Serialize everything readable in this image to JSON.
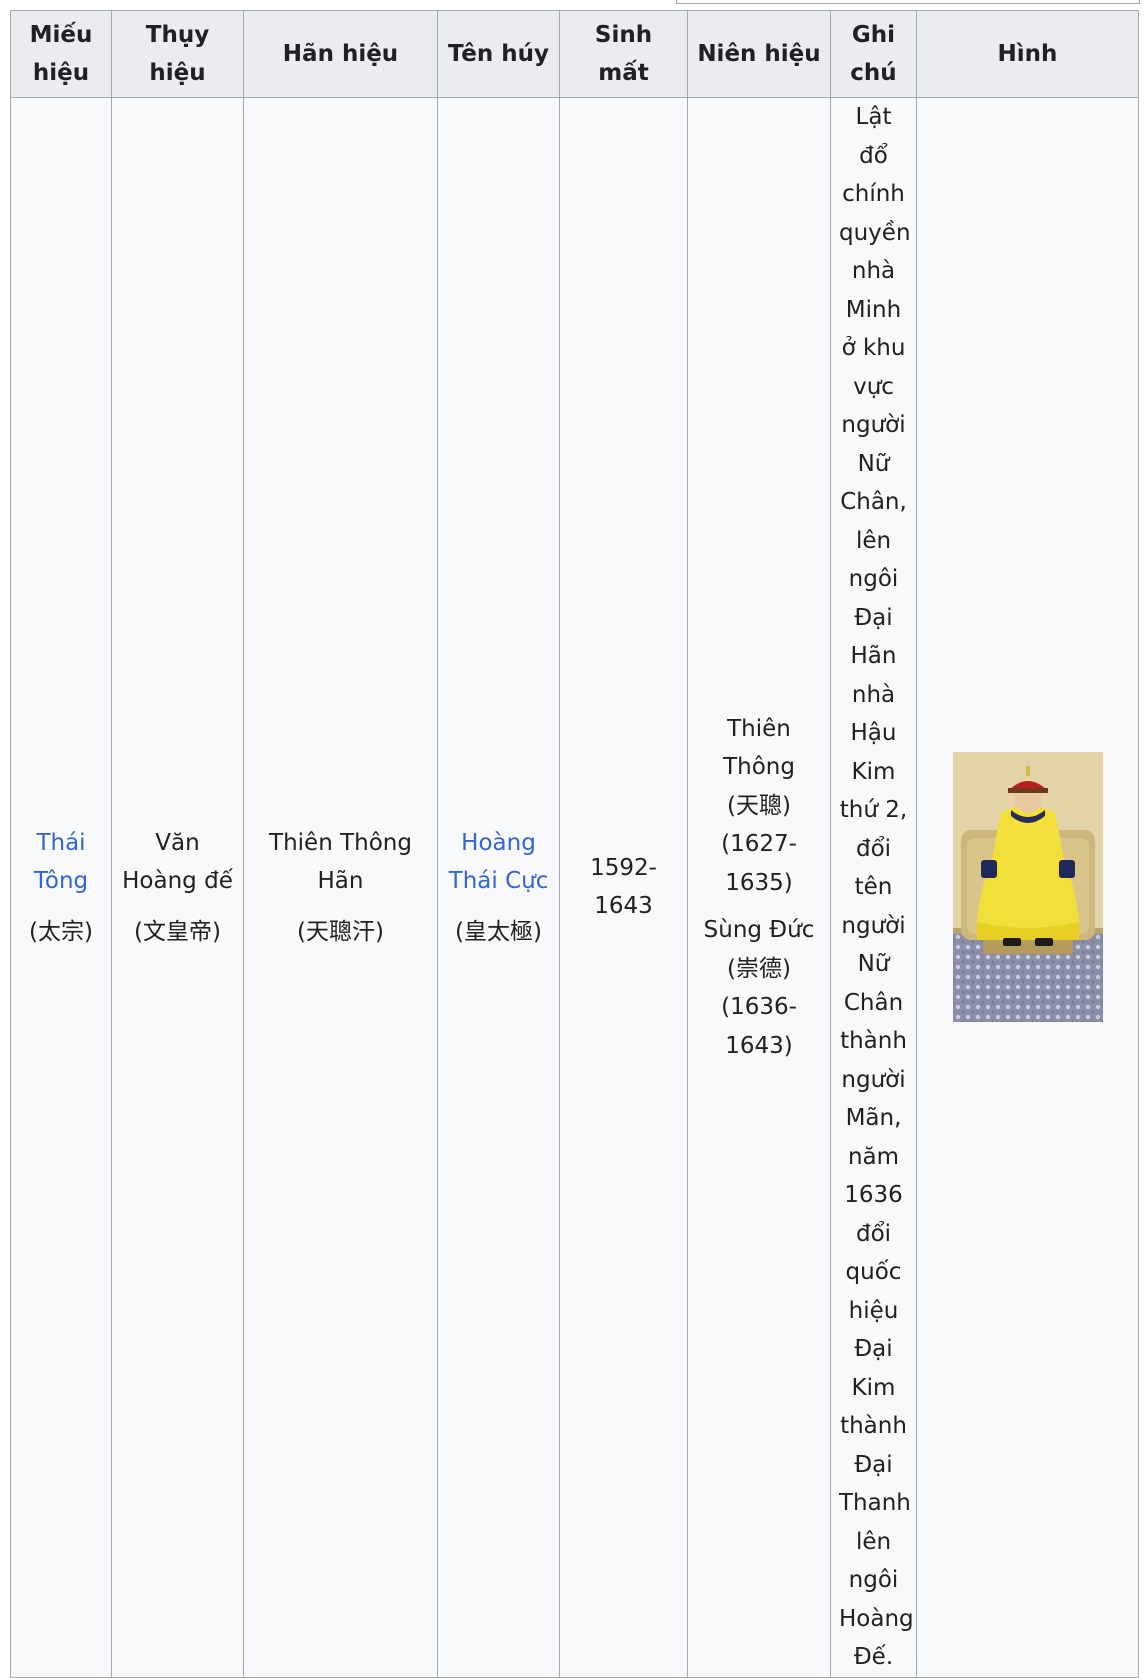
{
  "table": {
    "headers": [
      "Miếu hiệu",
      "Thụy hiệu",
      "Hãn hiệu",
      "Tên húy",
      "Sinh mất",
      "Niên hiệu",
      "Ghi chú",
      "Hình"
    ],
    "row": {
      "temple_name": "Thái Tông",
      "temple_name_cjk": "(太宗)",
      "posthumous_name": "Văn Hoàng đế",
      "posthumous_name_cjk": "(文皇帝)",
      "khan_title": "Thiên Thông Hãn",
      "khan_title_cjk": "(天聰汗)",
      "personal_name": "Hoàng Thái Cực",
      "personal_name_cjk": "(皇太極)",
      "lifespan": "1592-1643",
      "eras": [
        {
          "name": "Thiên Thông",
          "cjk": "(天聰)",
          "years": "(1627-1635)"
        },
        {
          "name": "Sùng Đức",
          "cjk": "(崇德)",
          "years": "(1636-1643)"
        }
      ],
      "note": "Lật đổ chính quyền nhà Minh ở khu vực người Nữ Chân, lên ngôi Đại Hãn nhà Hậu Kim thứ 2, đổi tên người Nữ Chân thành người Mãn, năm 1636 đổi quốc hiệu Đại Kim thành Đại Thanh lên ngôi Hoàng Đế.",
      "image_subject": "emperor-portrait"
    }
  },
  "colors": {
    "link": "#3366cc",
    "header_bg": "#eaecf0",
    "cell_bg": "#f8f9fa",
    "border": "#a2a9b1",
    "text": "#202122"
  }
}
